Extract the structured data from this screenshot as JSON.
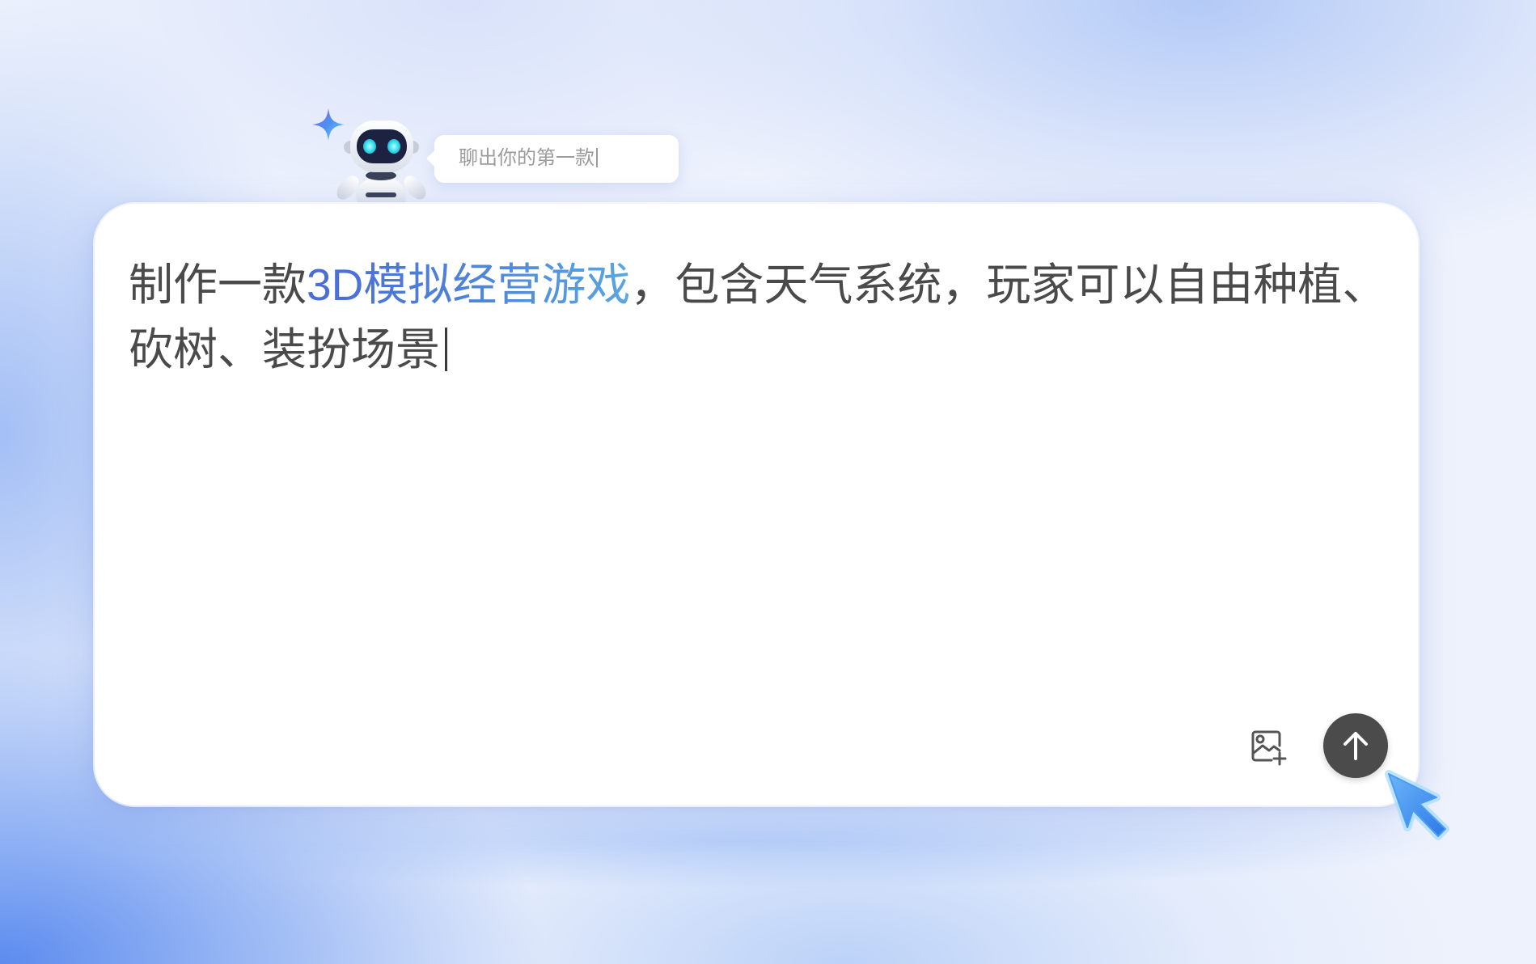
{
  "bubble": {
    "text": "聊出你的第一款"
  },
  "prompt": {
    "line1_before": "制作一款",
    "line1_highlight": "3D模拟经营游戏",
    "line1_after": "，包含天气系统，玩家可以自由种植、",
    "line2": "砍树、装扮场景"
  },
  "toolbar": {
    "add_image_icon": "image-add-icon",
    "send_icon": "arrow-up-icon"
  },
  "mascot": {
    "icon": "robot-mascot-icon",
    "sparkle_icon": "sparkle-icon"
  },
  "pointer": {
    "icon": "mouse-pointer-icon"
  },
  "colors": {
    "text": "#4a4a4a",
    "highlight_start": "#4a6bd6",
    "highlight_end": "#5aa6e2",
    "send_button": "#4b4b4b",
    "pointer": "#3d8cf0",
    "robot_eyes": "#43e3f0"
  }
}
